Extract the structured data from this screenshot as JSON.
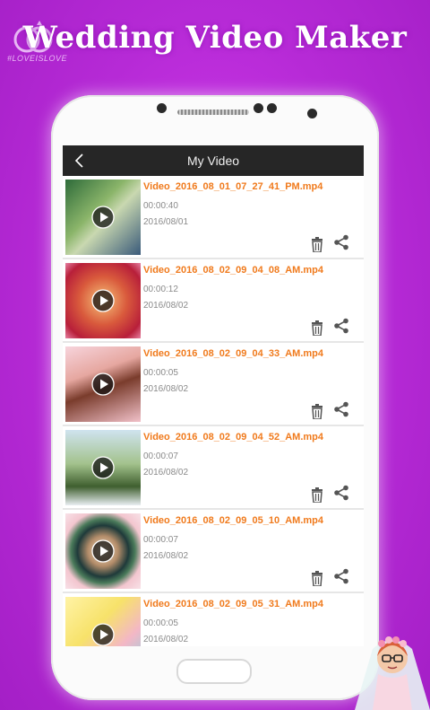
{
  "banner": {
    "title": "Wedding Video Maker",
    "logo_text": "#LOVEISLOVE"
  },
  "appbar": {
    "title": "My Video"
  },
  "videos": [
    {
      "name": "Video_2016_08_01_07_27_41_PM.mp4",
      "duration": "00:00:40",
      "date": "2016/08/01",
      "thumb": "green"
    },
    {
      "name": "Video_2016_08_02_09_04_08_AM.mp4",
      "duration": "00:00:12",
      "date": "2016/08/02",
      "thumb": "red"
    },
    {
      "name": "Video_2016_08_02_09_04_33_AM.mp4",
      "duration": "00:00:05",
      "date": "2016/08/02",
      "thumb": "pink"
    },
    {
      "name": "Video_2016_08_02_09_04_52_AM.mp4",
      "duration": "00:00:07",
      "date": "2016/08/02",
      "thumb": "outdoor"
    },
    {
      "name": "Video_2016_08_02_09_05_10_AM.mp4",
      "duration": "00:00:07",
      "date": "2016/08/02",
      "thumb": "circle"
    },
    {
      "name": "Video_2016_08_02_09_05_31_AM.mp4",
      "duration": "00:00:05",
      "date": "2016/08/02",
      "thumb": "yellow"
    }
  ],
  "colors": {
    "accent": "#f07a1c",
    "appbar": "#262626",
    "background": "#b62ad6"
  }
}
